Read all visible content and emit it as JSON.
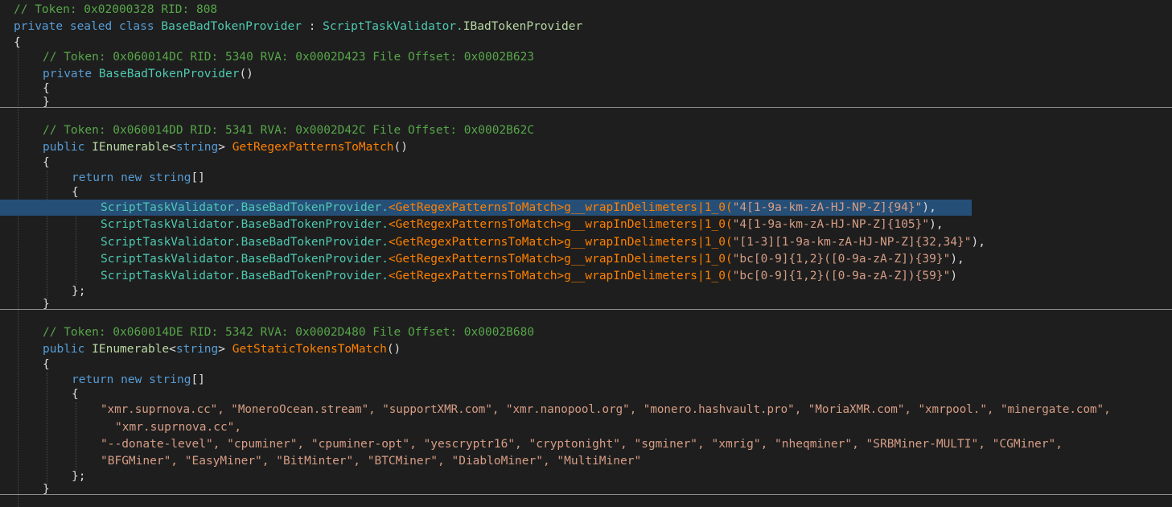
{
  "class_header": {
    "token_comment": "// Token: 0x02000328 RID: 808",
    "kw_private": "private",
    "kw_sealed": "sealed",
    "kw_class": "class",
    "class_name": "BaseBadTokenProvider",
    "colon": ":",
    "base_ns": "ScriptTaskValidator.",
    "base_iface": "IBadTokenProvider",
    "open_brace": "{"
  },
  "ctor": {
    "token_comment": "// Token: 0x060014DC RID: 5340 RVA: 0x0002D423 File Offset: 0x0002B623",
    "kw_private": "private",
    "name": "BaseBadTokenProvider",
    "parens": "()",
    "open_brace": "{",
    "close_brace": "}"
  },
  "regex_method": {
    "token_comment": "// Token: 0x060014DD RID: 5341 RVA: 0x0002D42C File Offset: 0x0002B62C",
    "kw_public": "public",
    "return_type": "IEnumerable",
    "generic_open": "<",
    "generic_arg": "string",
    "generic_close": ">",
    "name": "GetRegexPatternsToMatch",
    "parens": "()",
    "open_brace": "{",
    "kw_return": "return",
    "kw_new": "new",
    "kw_string": "string",
    "array_brackets": "[]",
    "array_open": "{",
    "call_prefix": "ScriptTaskValidator.BaseBadTokenProvider.",
    "call_method": "<GetRegexPatternsToMatch>",
    "call_suffix": "g__wrapInDelimeters|1_0(",
    "patterns": [
      {
        "value": "\"4[1-9a-km-zA-HJ-NP-Z]{94}\"",
        "tail": "),"
      },
      {
        "value": "\"4[1-9a-km-zA-HJ-NP-Z]{105}\"",
        "tail": "),"
      },
      {
        "value": "\"[1-3][1-9a-km-zA-HJ-NP-Z]{32,34}\"",
        "tail": "),"
      },
      {
        "value": "\"bc[0-9]{1,2}([0-9a-zA-Z]){39}\"",
        "tail": "),"
      },
      {
        "value": "\"bc[0-9]{1,2}([0-9a-zA-Z]){59}\"",
        "tail": ")"
      }
    ],
    "array_close": "};",
    "close_brace": "}"
  },
  "static_method": {
    "token_comment": "// Token: 0x060014DE RID: 5342 RVA: 0x0002D480 File Offset: 0x0002B680",
    "kw_public": "public",
    "return_type": "IEnumerable",
    "generic_open": "<",
    "generic_arg": "string",
    "generic_close": ">",
    "name": "GetStaticTokensToMatch",
    "parens": "()",
    "open_brace": "{",
    "kw_return": "return",
    "kw_new": "new",
    "kw_string": "string",
    "array_brackets": "[]",
    "array_open": "{",
    "tokens_line1": "\"xmr.suprnova.cc\", \"MoneroOcean.stream\", \"supportXMR.com\", \"xmr.nanopool.org\", \"monero.hashvault.pro\", \"MoriaXMR.com\", \"xmrpool.\", \"minergate.com\",",
    "tokens_line2": "\"xmr.suprnova.cc\",",
    "tokens_line3": "\"--donate-level\", \"cpuminer\", \"cpuminer-opt\", \"yescryptr16\", \"cryptonight\", \"sgminer\", \"xmrig\", \"nheqminer\", \"SRBMiner-MULTI\", \"CGMiner\",",
    "tokens_line4": "\"BFGMiner\", \"EasyMiner\", \"BitMinter\", \"BTCMiner\", \"DiabloMiner\", \"MultiMiner\"",
    "array_close": "};",
    "close_brace": "}"
  },
  "colors": {
    "background": "#1e1e1e",
    "comment": "#57a64a",
    "keyword": "#569cd6",
    "type": "#4ec9b0",
    "method": "#ff8000",
    "string": "#d69d85",
    "selection": "#264f78"
  }
}
